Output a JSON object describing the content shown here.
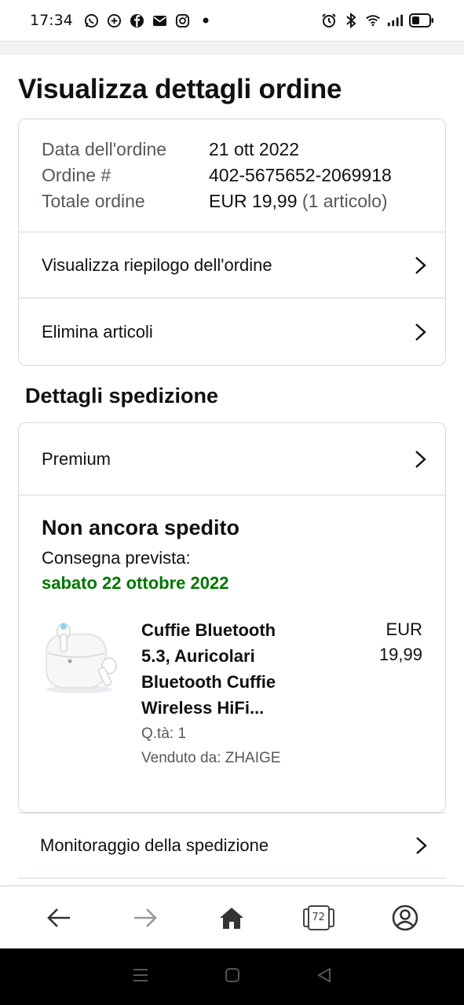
{
  "status_bar": {
    "time": "17:34",
    "left_icons": [
      "whatsapp-icon",
      "signal-icon",
      "facebook-icon",
      "mail-icon",
      "instagram-icon",
      "dot-icon"
    ],
    "right_icons": [
      "alarm-icon",
      "bluetooth-icon",
      "wifi-icon",
      "cell-signal-icon",
      "battery-icon"
    ]
  },
  "page": {
    "title": "Visualizza dettagli ordine"
  },
  "order_info": {
    "date_label": "Data dell'ordine",
    "date_value": "21 ott 2022",
    "number_label": "Ordine #",
    "number_value": "402-5675652-2069918",
    "total_label": "Totale ordine",
    "total_value": "EUR 19,99",
    "total_items": "(1 articolo)"
  },
  "order_links": {
    "summary": "Visualizza riepilogo dell'ordine",
    "delete_items": "Elimina articoli"
  },
  "shipping": {
    "section_title": "Dettagli spedizione",
    "speed": "Premium",
    "status": "Non ancora spedito",
    "expected_label": "Consegna prevista:",
    "expected_date": "sabato 22 ottobre 2022",
    "date_color": "#007600"
  },
  "product": {
    "title_lines": [
      "Cuffie Bluetooth",
      "5.3, Auricolari",
      "Bluetooth Cuffie",
      "Wireless HiFi..."
    ],
    "quantity": "Q.tà: 1",
    "seller": "Venduto da: ZHAIGE",
    "price_currency": "EUR",
    "price_value": "19,99"
  },
  "tracking": {
    "label": "Monitoraggio della spedizione"
  },
  "bottom_nav": {
    "tabs_count": "72",
    "items": [
      "back-icon",
      "forward-icon",
      "home-icon",
      "tabs-icon",
      "account-icon"
    ]
  },
  "system_nav": {
    "items": [
      "menu-icon",
      "home-square-icon",
      "back-triangle-icon"
    ]
  }
}
